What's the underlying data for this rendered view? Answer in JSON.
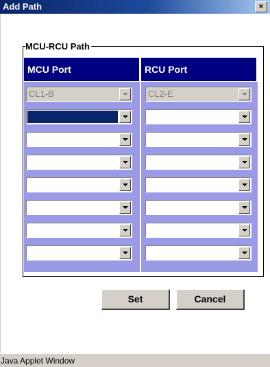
{
  "window": {
    "title": "Add Path",
    "close_glyph": "×"
  },
  "group": {
    "label": "MCU-RCU Path"
  },
  "columns": {
    "mcu_header": "MCU Port",
    "rcu_header": "RCU Port"
  },
  "rows": [
    {
      "mcu": "CL1-B",
      "rcu": "CL2-E",
      "state": "disabled"
    },
    {
      "mcu": "",
      "rcu": "",
      "state": "mcu-selected"
    },
    {
      "mcu": "",
      "rcu": "",
      "state": "normal"
    },
    {
      "mcu": "",
      "rcu": "",
      "state": "normal"
    },
    {
      "mcu": "",
      "rcu": "",
      "state": "normal"
    },
    {
      "mcu": "",
      "rcu": "",
      "state": "normal"
    },
    {
      "mcu": "",
      "rcu": "",
      "state": "normal"
    },
    {
      "mcu": "",
      "rcu": "",
      "state": "normal"
    }
  ],
  "buttons": {
    "set_label": "Set",
    "cancel_label": "Cancel"
  },
  "status": {
    "text": "Java Applet Window"
  },
  "colors": {
    "header_bg": "#000080",
    "grid_bg": "#9a9ae6",
    "selection": "#0a246a",
    "titlebar": "#0a246a"
  }
}
